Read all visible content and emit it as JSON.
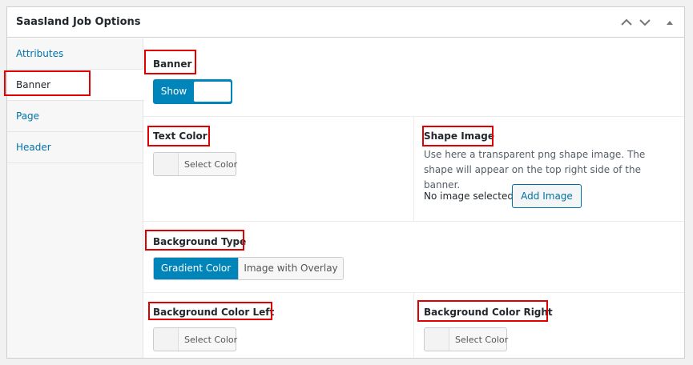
{
  "metabox": {
    "title": "Saasland Job Options",
    "controls": [
      "chevron-up-icon",
      "chevron-down-icon",
      "triangle-up-icon"
    ]
  },
  "tabs": [
    {
      "label": "Attributes",
      "active": false
    },
    {
      "label": "Banner",
      "active": true
    },
    {
      "label": "Page",
      "active": false
    },
    {
      "label": "Header",
      "active": false
    }
  ],
  "fields": {
    "banner": {
      "label": "Banner",
      "switch_on_label": "Show"
    },
    "text_color": {
      "label": "Text Color",
      "button": "Select Color"
    },
    "shape_image": {
      "label": "Shape Image",
      "description": "Use here a transparent png shape image. The shape will appear on the top right side of the banner.",
      "status": "No image selected",
      "button": "Add Image"
    },
    "background_type": {
      "label": "Background Type",
      "options": [
        "Gradient Color",
        "Image with Overlay"
      ],
      "selected": "Gradient Color"
    },
    "bg_color_left": {
      "label": "Background Color Left",
      "button": "Select Color"
    },
    "bg_color_right": {
      "label": "Background Color Right",
      "button": "Select Color"
    }
  },
  "colors": {
    "accent": "#0085ba",
    "link": "#0073aa",
    "highlight_box": "#e00000",
    "border": "#ccd0d4"
  }
}
